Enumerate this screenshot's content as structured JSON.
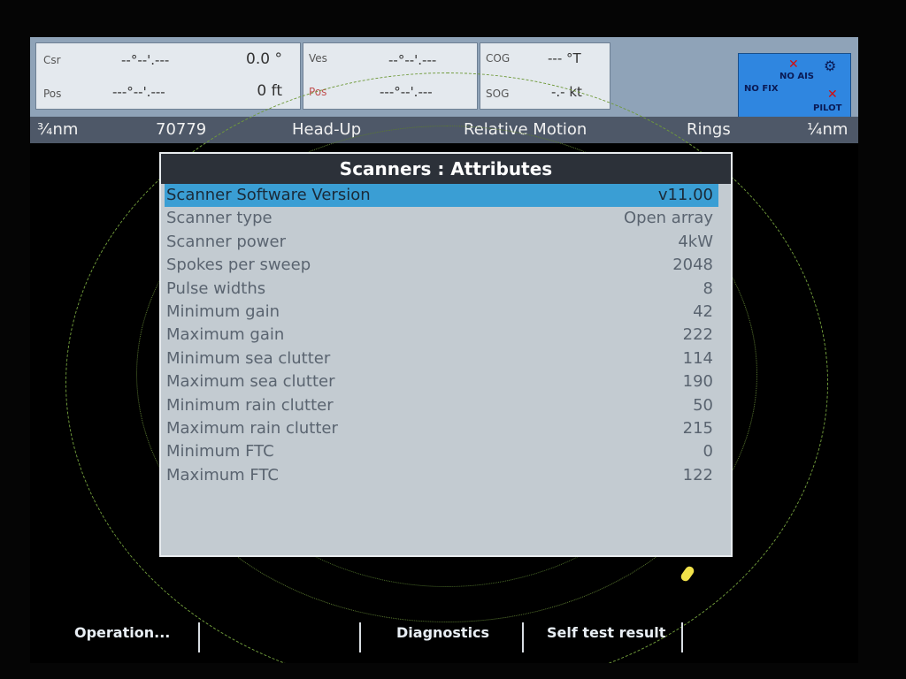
{
  "status": {
    "csr": {
      "label": "Csr",
      "value": "--°--'.---",
      "reading": "0.0 °"
    },
    "pos": {
      "label": "Pos",
      "value": "---°--'.---",
      "reading": "0 ft"
    },
    "ves": {
      "label": "Ves",
      "value": "--°--'.---"
    },
    "vpos": {
      "label": "Pos",
      "value": "---°--'.---"
    },
    "cog": {
      "label": "COG",
      "value": "--- °T"
    },
    "sog": {
      "label": "SOG",
      "value": "-.- kt"
    }
  },
  "status_icons": {
    "no_fix": "NO FIX",
    "no_ais": "NO AIS",
    "pilot": "PILOT"
  },
  "infobar": {
    "range": "¾nm",
    "number": "70779",
    "orientation": "Head-Up",
    "motion": "Relative Motion",
    "rings": "Rings",
    "ring_range": "¼nm"
  },
  "dialog": {
    "title": "Scanners : Attributes",
    "rows": [
      {
        "key": "Scanner Software Version",
        "value": "v11.00"
      },
      {
        "key": "Scanner type",
        "value": "Open array"
      },
      {
        "key": "Scanner power",
        "value": "4kW"
      },
      {
        "key": "Spokes per sweep",
        "value": "2048"
      },
      {
        "key": "Pulse widths",
        "value": "8"
      },
      {
        "key": "Minimum gain",
        "value": "42"
      },
      {
        "key": "Maximum gain",
        "value": "222"
      },
      {
        "key": "Minimum sea clutter",
        "value": "114"
      },
      {
        "key": "Maximum sea clutter",
        "value": "190"
      },
      {
        "key": "Minimum rain clutter",
        "value": "50"
      },
      {
        "key": "Maximum rain clutter",
        "value": "215"
      },
      {
        "key": "Minimum FTC",
        "value": "0"
      },
      {
        "key": "Maximum FTC",
        "value": "122"
      }
    ]
  },
  "softkeys": {
    "operation": "Operation...",
    "diagnostics": "Diagnostics",
    "self_test": "Self test result"
  },
  "colors": {
    "topbar": "#8fa3b8",
    "infobar": "#4e5868",
    "dialog_bg": "#c3cbd1",
    "dialog_title": "#2c3139",
    "selection": "#3a9ed4",
    "ring": "#6f9a3a",
    "echo": "#f2e24a"
  }
}
